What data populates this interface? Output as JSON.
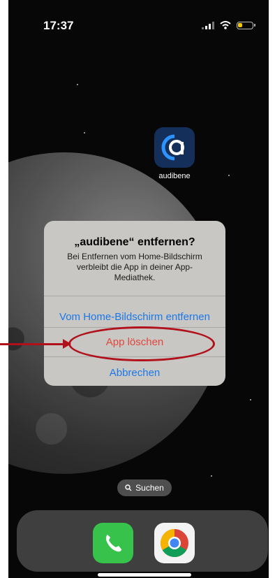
{
  "status_bar": {
    "time": "17:37",
    "signal_icon": "signal-bars-icon",
    "wifi_icon": "wifi-icon",
    "battery_icon": "battery-low-icon",
    "battery_color": "#f3c900"
  },
  "home_screen": {
    "apps": [
      {
        "label": "audibene",
        "icon": "audibene-logo-icon"
      }
    ],
    "search_label": "Suchen",
    "search_icon": "magnifier-icon"
  },
  "dialog": {
    "title": "„audibene“ entfernen?",
    "message": "Bei Entfernen vom Home-Bildschirm verbleibt die App in deiner App-Mediathek.",
    "actions": [
      {
        "label": "Vom Home-Bildschirm entfernen",
        "color": "#1b78e8"
      },
      {
        "label": "App löschen",
        "color": "#e0463c"
      },
      {
        "label": "Abbrechen",
        "color": "#1b78e8"
      }
    ]
  },
  "annotation": {
    "color": "#b0111a"
  },
  "dock": {
    "apps": [
      {
        "name": "Telefon",
        "icon": "phone-icon"
      },
      {
        "name": "Chrome",
        "icon": "chrome-icon"
      }
    ]
  }
}
